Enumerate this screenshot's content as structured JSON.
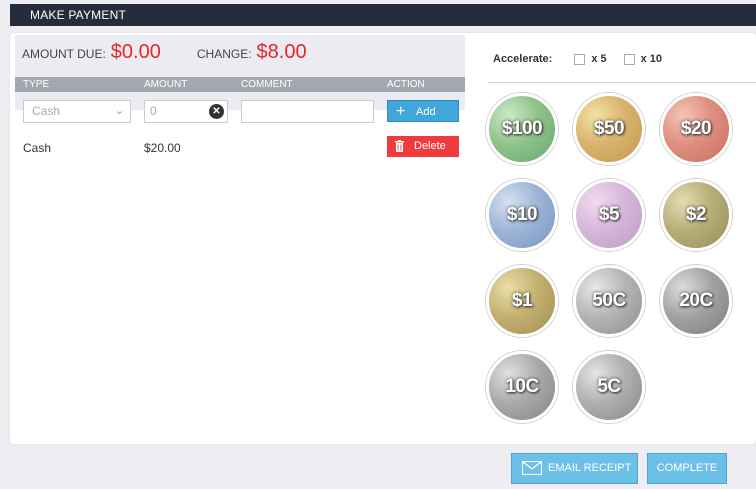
{
  "title": "MAKE PAYMENT",
  "summary": {
    "amount_due_label": "AMOUNT DUE:",
    "amount_due_value": "$0.00",
    "change_label": "CHANGE:",
    "change_value": "$8.00"
  },
  "table": {
    "headers": [
      "TYPE",
      "AMOUNT",
      "COMMENT",
      "ACTION"
    ],
    "entry": {
      "type_value": "Cash",
      "amount_placeholder": "0",
      "add_label": "Add"
    },
    "rows": [
      {
        "type": "Cash",
        "amount": "$20.00",
        "action_label": "Delete"
      }
    ]
  },
  "accelerate": {
    "label": "Accelerate:",
    "options": [
      "x 5",
      "x 10"
    ]
  },
  "denominations": [
    "$100",
    "$50",
    "$20",
    "$10",
    "$5",
    "$2",
    "$1",
    "50C",
    "20C",
    "10C",
    "5C"
  ],
  "footer": {
    "email_label": "EMAIL RECEIPT",
    "complete_label": "COMPLETE"
  },
  "colors": {
    "titlebar": "#252c3b",
    "amount_red": "#e8262b",
    "add_blue": "#41a6dc",
    "delete_red": "#ef3b3b",
    "footer_blue": "#6cc0e8"
  }
}
